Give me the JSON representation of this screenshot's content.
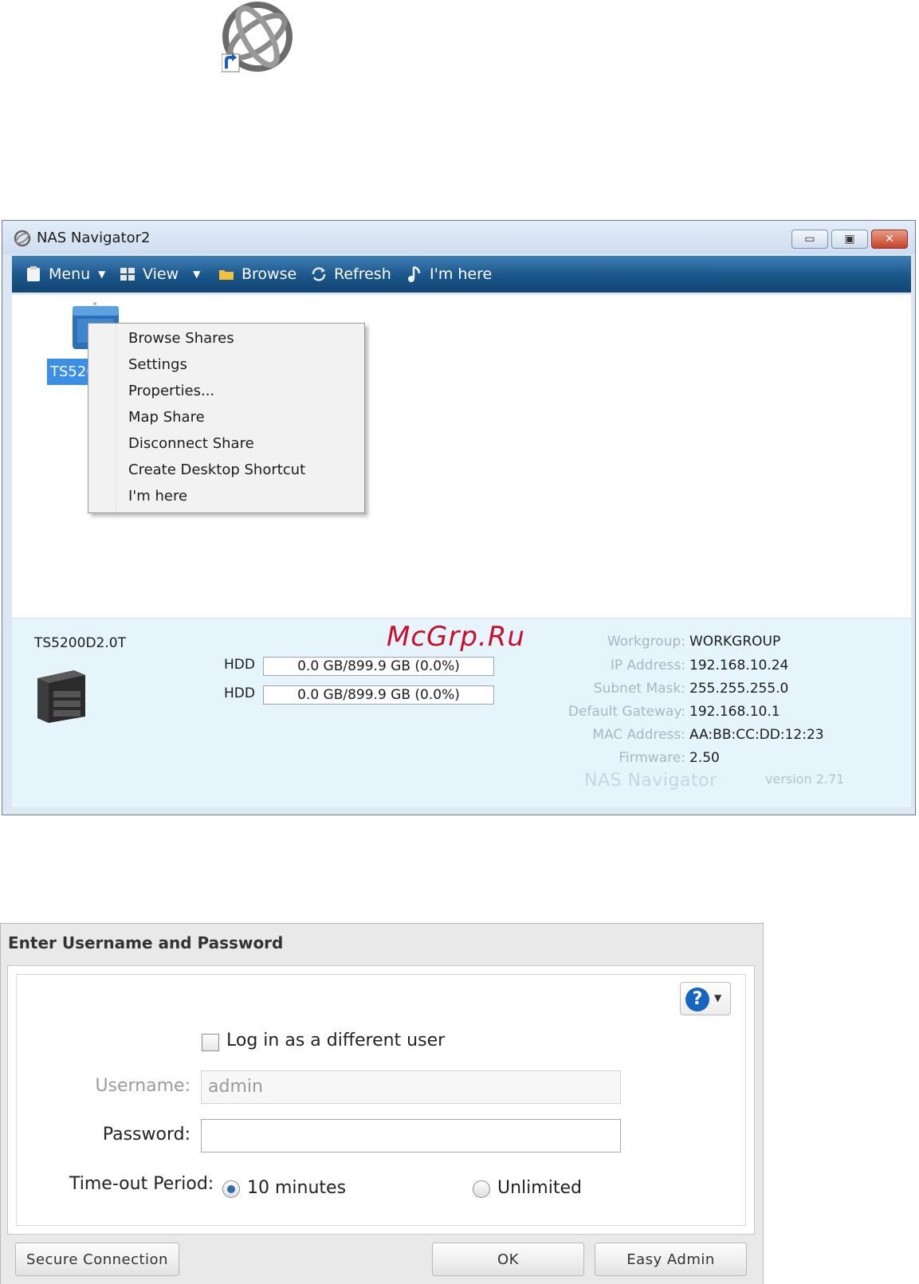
{
  "nas_window": {
    "title": "NAS Navigator2",
    "toolbar": {
      "menu": "Menu",
      "view": "View",
      "browse": "Browse",
      "refresh": "Refresh",
      "im_here": "I'm here"
    },
    "device_label": "TS5200D2.0T",
    "context_menu": [
      "Browse Shares",
      "Settings",
      "Properties...",
      "Map Share",
      "Disconnect Share",
      "Create Desktop Shortcut",
      "I'm here"
    ],
    "info": {
      "name": "TS5200D2.0T",
      "hdd": [
        {
          "label": "HDD",
          "usage": "0.0 GB/899.9 GB (0.0%)",
          "percent": 0.0
        },
        {
          "label": "HDD",
          "usage": "0.0 GB/899.9 GB (0.0%)",
          "percent": 0.0
        }
      ],
      "network": [
        {
          "key": "Workgroup:",
          "value": "WORKGROUP"
        },
        {
          "key": "IP Address:",
          "value": "192.168.10.24"
        },
        {
          "key": "Subnet Mask:",
          "value": "255.255.255.0"
        },
        {
          "key": "Default Gateway:",
          "value": "192.168.10.1"
        },
        {
          "key": "MAC Address:",
          "value": "AA:BB:CC:DD:12:23"
        },
        {
          "key": "Firmware:",
          "value": "2.50"
        }
      ],
      "brand": "NAS Navigator",
      "version": "version 2.71"
    },
    "watermark": "McGrp.Ru"
  },
  "login_dialog": {
    "title": "Enter Username and Password",
    "help": "?",
    "different_user": "Log in as a different user",
    "username_label": "Username:",
    "username_value": "admin",
    "password_label": "Password:",
    "timeout_label": "Time-out Period:",
    "timeout_options": [
      "10 minutes",
      "Unlimited"
    ],
    "timeout_selected": "10 minutes",
    "buttons": {
      "secure": "Secure Connection",
      "ok": "OK",
      "easy_admin": "Easy Admin"
    }
  },
  "colors": {
    "toolbar": "#1b5589",
    "info_panel": "#e6f4fb",
    "selection": "#3b8fe4",
    "watermark": "#c8102e",
    "help": "#1665c1"
  }
}
